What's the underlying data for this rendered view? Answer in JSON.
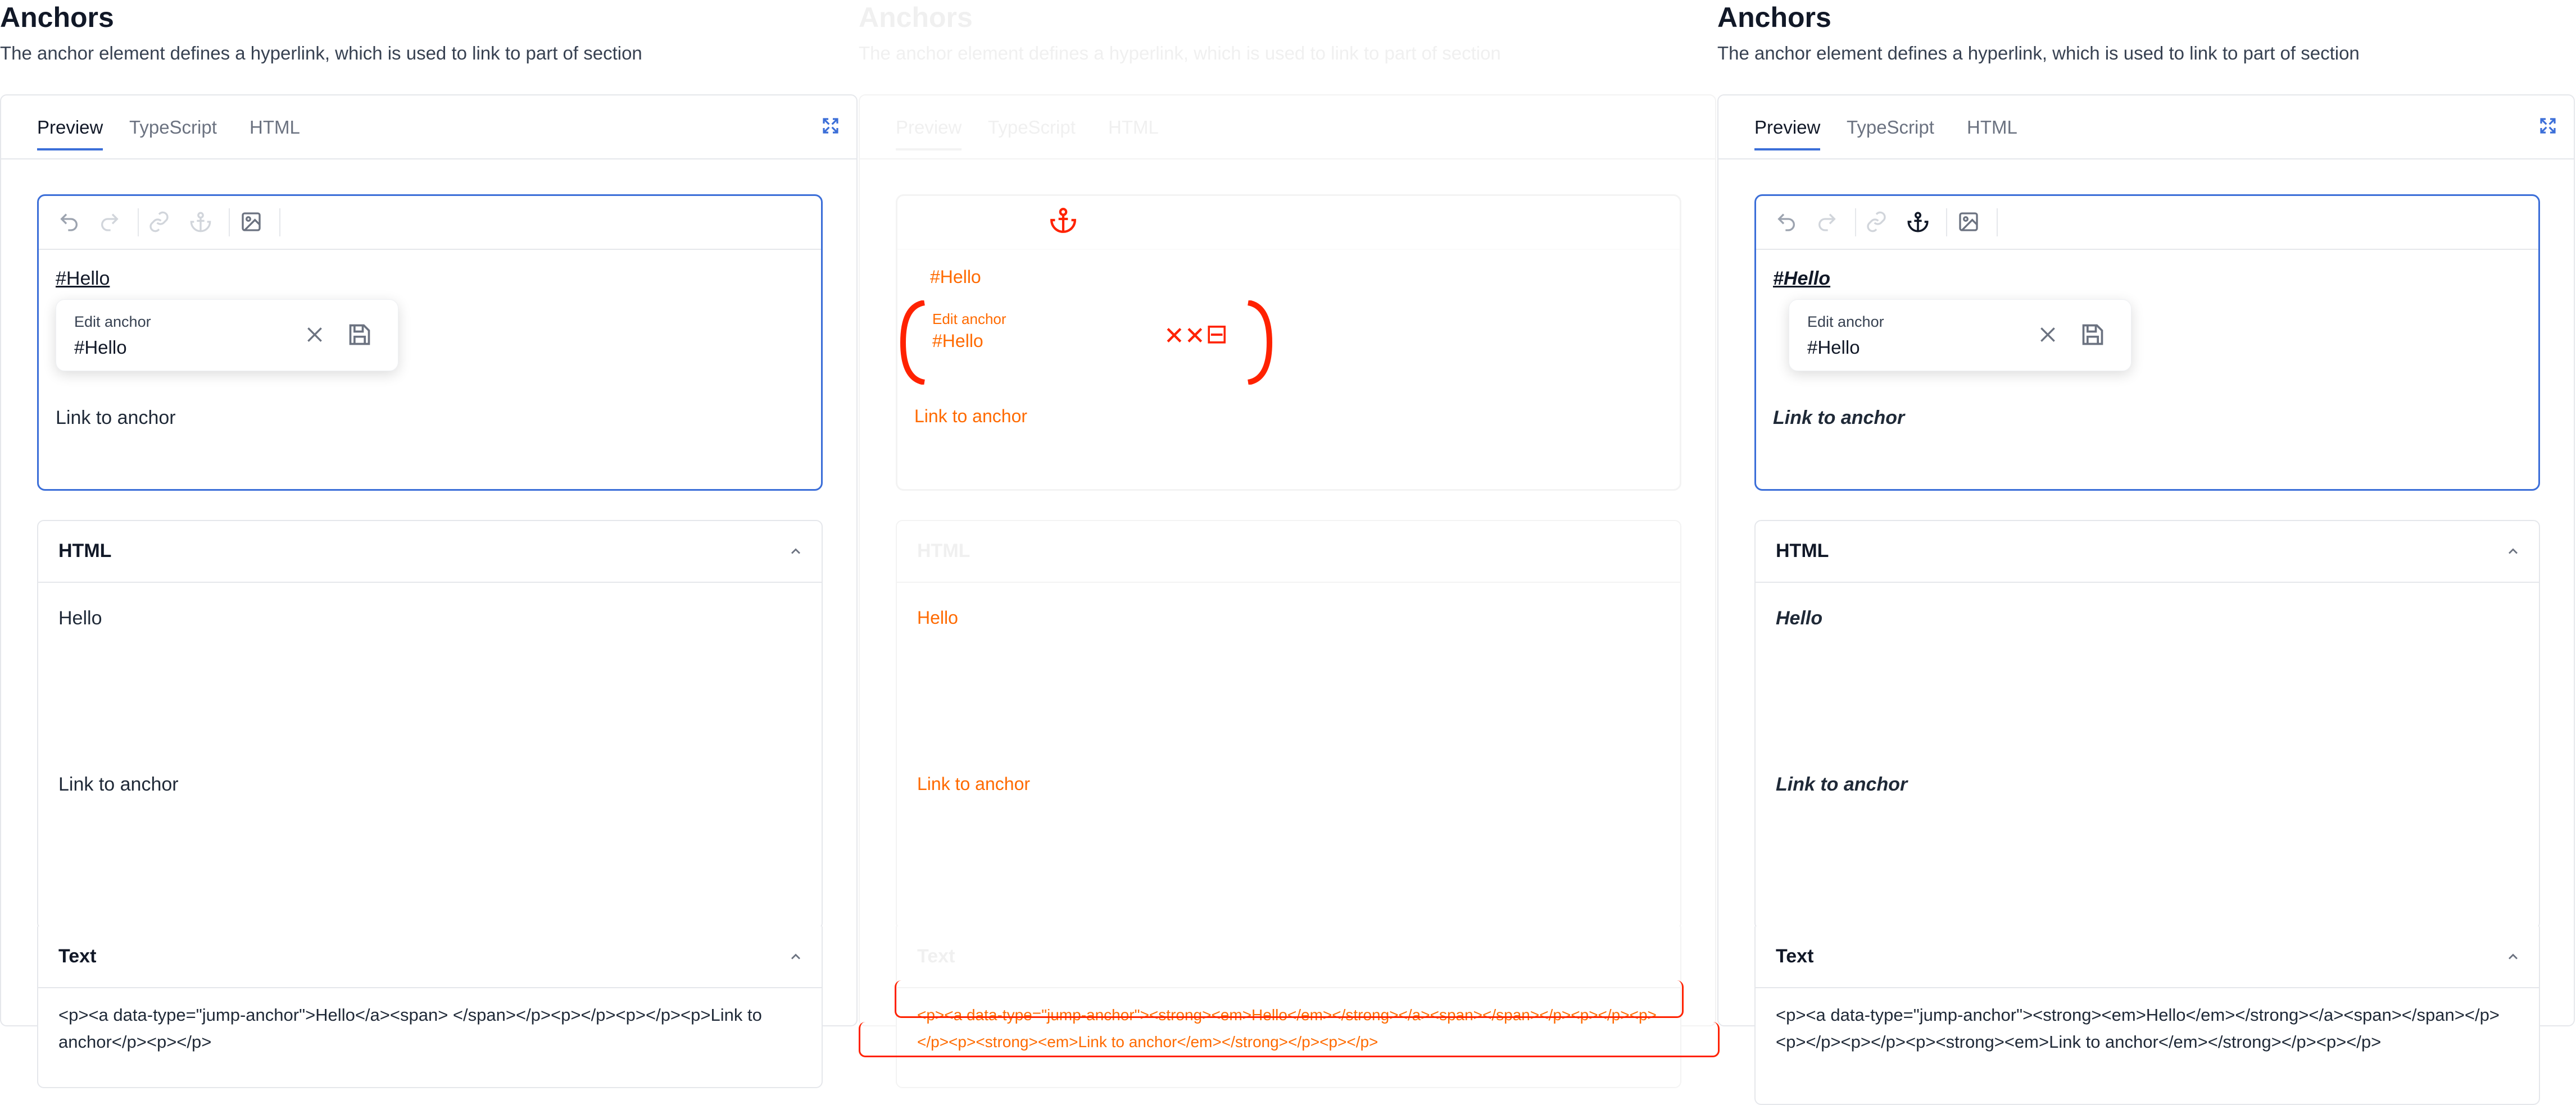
{
  "page": {
    "title": "Anchors",
    "description": "The anchor element defines a hyperlink, which is used to link to part of section"
  },
  "tabs": [
    "Preview",
    "TypeScript",
    "HTML"
  ],
  "toolbar": {
    "icons": [
      "undo-icon",
      "redo-icon",
      "link-icon",
      "anchor-icon",
      "image-icon"
    ]
  },
  "editor": {
    "anchor_text": "#Hello",
    "popup": {
      "label": "Edit anchor",
      "value": "#Hello"
    },
    "paragraph": "Link to anchor"
  },
  "html_section": {
    "title": "HTML",
    "line1": "Hello",
    "line2": "Link to anchor"
  },
  "text_section": {
    "title": "Text",
    "content_left": "<p><a data-type=\"jump-anchor\">Hello</a><span> </span></p><p></p><p></p><p>Link to anchor</p><p></p>",
    "content_right": "<p><a data-type=\"jump-anchor\"><strong><em>Hello</em></strong></a><span></span></p><p></p><p></p><p><strong><em>Link to anchor</em></strong></p><p></p>"
  },
  "colors": {
    "accent": "#3b6ed8",
    "border": "#e5e7eb",
    "diff_orange": "#ff6a00",
    "diff_red": "#ff2200"
  }
}
